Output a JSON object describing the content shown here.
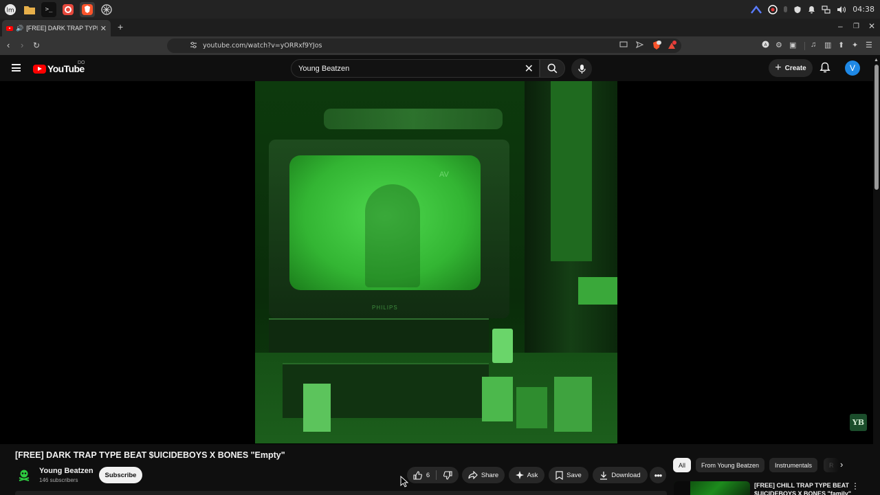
{
  "os_panel": {
    "clock": "04:38",
    "apps": [
      "mint-menu-icon",
      "files-icon",
      "terminal-icon",
      "firefox-icon",
      "brave-icon",
      "tor-icon"
    ]
  },
  "browser": {
    "tab_title": "[FREE] DARK TRAP TYPE BEAT",
    "url": "youtube.com/watch?v=yORRxf9YJos"
  },
  "youtube_header": {
    "logo_text": "YouTube",
    "region_code": "DO",
    "search_value": "Young Beatzen",
    "create_label": "Create",
    "avatar_letter": "V"
  },
  "player": {
    "tv_overlay_text": "AV",
    "tv_brand": "PHILIPS",
    "watermark": "YB"
  },
  "video": {
    "title": "[FREE] DARK TRAP TYPE BEAT $UICIDEBOYS X BONES \"Empty\"",
    "channel_name": "Young Beatzen",
    "subscribers": "146 subscribers",
    "subscribe_label": "Subscribe",
    "like_count": "6",
    "share_label": "Share",
    "ask_label": "Ask",
    "save_label": "Save",
    "download_label": "Download"
  },
  "chips": {
    "all": "All",
    "from_channel": "From Young Beatzen",
    "instrumentals": "Instrumentals",
    "partial": "R"
  },
  "recommended": {
    "title_line1": "[FREE] CHILL TRAP TYPE BEAT",
    "title_line2": "$UICIDEBOYS X BONES \"family\""
  },
  "colors": {
    "accent_red": "#ff0000",
    "avatar_blue": "#1e88e5",
    "page_bg": "#0f0f0f"
  }
}
